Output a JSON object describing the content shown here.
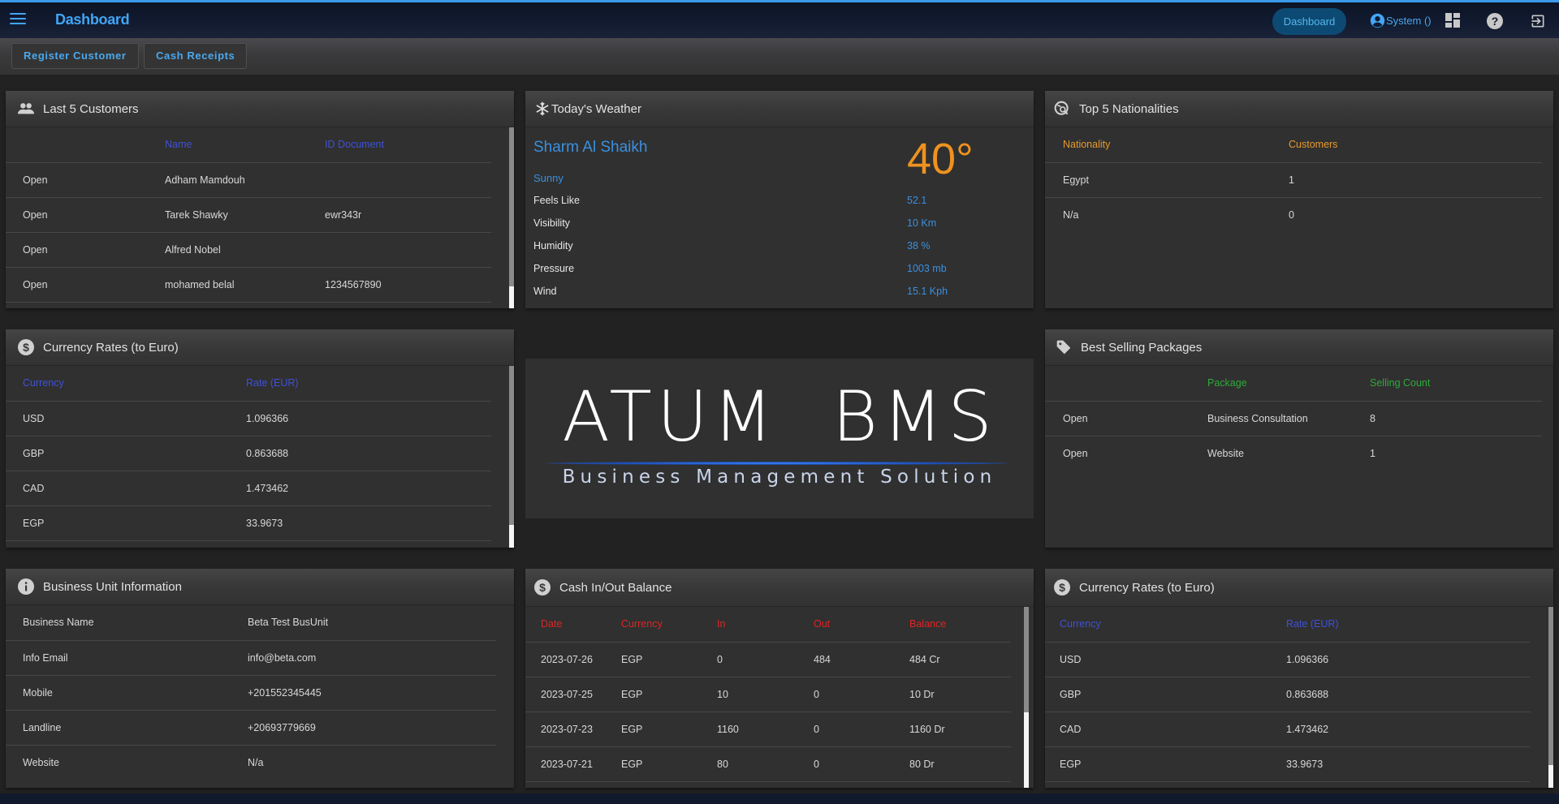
{
  "topbar": {
    "title": "Dashboard",
    "nav_pill": "Dashboard",
    "user": "System ()",
    "icons": [
      "menu-icon",
      "account-circle-icon",
      "dashboard-grid-icon",
      "help-icon",
      "logout-icon"
    ]
  },
  "actions": {
    "register_customer": "Register Customer",
    "cash_receipts": "Cash Receipts"
  },
  "last_customers": {
    "title": "Last 5 Customers",
    "icon": "people-icon",
    "header_color": "#3f51d6",
    "columns": [
      "",
      "Name",
      "ID Document"
    ],
    "rows": [
      {
        "action": "Open",
        "name": "Adham Mamdouh",
        "id_doc": ""
      },
      {
        "action": "Open",
        "name": "Tarek Shawky",
        "id_doc": "ewr343r"
      },
      {
        "action": "Open",
        "name": "Alfred Nobel",
        "id_doc": ""
      },
      {
        "action": "Open",
        "name": "mohamed belal",
        "id_doc": "1234567890"
      }
    ]
  },
  "weather": {
    "title": "Today's Weather",
    "icon": "snowflake-icon",
    "city": "Sharm Al Shaikh",
    "temperature": "40°",
    "condition": "Sunny",
    "details": [
      {
        "label": "Feels Like",
        "value": "52.1"
      },
      {
        "label": "Visibility",
        "value": "10 Km"
      },
      {
        "label": "Humidity",
        "value": "38 %"
      },
      {
        "label": "Pressure",
        "value": "1003 mb"
      },
      {
        "label": "Wind",
        "value": "15.1 Kph"
      }
    ]
  },
  "nationalities": {
    "title": "Top 5 Nationalities",
    "icon": "travel-explore-icon",
    "header_color": "#e89a2c",
    "columns": [
      "Nationality",
      "Customers"
    ],
    "rows": [
      {
        "nationality": "Egypt",
        "customers": "1"
      },
      {
        "nationality": "N/a",
        "customers": "0"
      }
    ]
  },
  "currency_rates_left": {
    "title": "Currency Rates (to Euro)",
    "icon": "dollar-circle-icon",
    "header_color": "#3f51d6",
    "columns": [
      "Currency",
      "Rate (EUR)"
    ],
    "rows": [
      {
        "currency": "USD",
        "rate": "1.096366"
      },
      {
        "currency": "GBP",
        "rate": "0.863688"
      },
      {
        "currency": "CAD",
        "rate": "1.473462"
      },
      {
        "currency": "EGP",
        "rate": "33.9673"
      }
    ]
  },
  "logo": {
    "main": "ATUM  BMS",
    "sub": "Business Management Solution"
  },
  "best_packages": {
    "title": "Best Selling Packages",
    "icon": "tag-icon",
    "header_color": "#2eaa3a",
    "columns": [
      "",
      "Package",
      "Selling Count"
    ],
    "rows": [
      {
        "action": "Open",
        "package": "Business Consultation",
        "count": "8"
      },
      {
        "action": "Open",
        "package": "Website",
        "count": "1"
      }
    ]
  },
  "business_unit": {
    "title": "Business Unit Information",
    "icon": "info-icon",
    "rows": [
      {
        "label": "Business Name",
        "value": "Beta Test BusUnit"
      },
      {
        "label": "Info Email",
        "value": "info@beta.com"
      },
      {
        "label": "Mobile",
        "value": "+201552345445"
      },
      {
        "label": "Landline",
        "value": "+20693779669"
      },
      {
        "label": "Website",
        "value": "N/a"
      }
    ]
  },
  "cash_balance": {
    "title": "Cash In/Out Balance",
    "icon": "dollar-circle-icon",
    "header_color": "#e02424",
    "columns": [
      "Date",
      "Currency",
      "In",
      "Out",
      "Balance"
    ],
    "rows": [
      {
        "date": "2023-07-26",
        "currency": "EGP",
        "in": "0",
        "out": "484",
        "balance": "484 Cr"
      },
      {
        "date": "2023-07-25",
        "currency": "EGP",
        "in": "10",
        "out": "0",
        "balance": "10 Dr"
      },
      {
        "date": "2023-07-23",
        "currency": "EGP",
        "in": "1160",
        "out": "0",
        "balance": "1160 Dr"
      },
      {
        "date": "2023-07-21",
        "currency": "EGP",
        "in": "80",
        "out": "0",
        "balance": "80 Dr"
      }
    ]
  },
  "currency_rates_right": {
    "title": "Currency Rates (to Euro)",
    "icon": "dollar-circle-icon",
    "header_color": "#3f51d6",
    "columns": [
      "Currency",
      "Rate (EUR)"
    ],
    "rows": [
      {
        "currency": "USD",
        "rate": "1.096366"
      },
      {
        "currency": "GBP",
        "rate": "0.863688"
      },
      {
        "currency": "CAD",
        "rate": "1.473462"
      },
      {
        "currency": "EGP",
        "rate": "33.9673"
      }
    ]
  }
}
